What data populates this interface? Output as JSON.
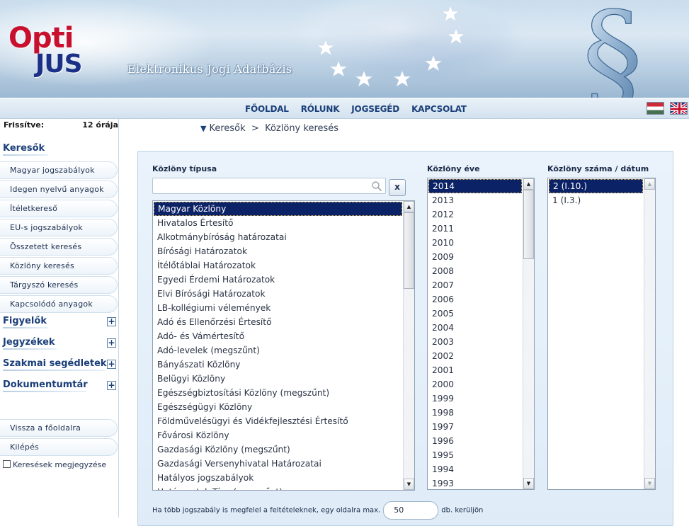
{
  "header": {
    "logo_opti": "Opti",
    "logo_jus": "JUS",
    "subtitle": "Elektronikus Jogi Adatbázis"
  },
  "nav": {
    "items": [
      "FŐOLDAL",
      "RÓLUNK",
      "JOGSEGÉD",
      "KAPCSOLAT"
    ]
  },
  "languages": [
    "hungarian-flag-icon",
    "uk-flag-icon"
  ],
  "sidebar": {
    "updated_label": "Frissítve:",
    "updated_value": "12 órája",
    "search_section": "Keresők",
    "search_items": [
      "Magyar jogszabályok",
      "Idegen nyelvű anyagok",
      "Ítéletkereső",
      "EU-s jogszabályok",
      "Összetett keresés",
      "Közlöny keresés",
      "Tárgyszó keresés",
      "Kapcsolódó anyagok"
    ],
    "collapsible_sections": [
      "Figyelők",
      "Jegyzékek",
      "Szakmai segédletek",
      "Dokumentumtár"
    ],
    "bottom_items": [
      "Vissza a főoldalra",
      "Kilépés"
    ],
    "remember_label": "Keresések megjegyzése"
  },
  "breadcrumb": {
    "root": "Keresők",
    "separator": ">",
    "current": "Közlöny keresés"
  },
  "form": {
    "type_label": "Közlöny típusa",
    "year_label": "Közlöny éve",
    "number_label": "Közlöny száma / dátum",
    "type_search_value": "",
    "clear_label": "x",
    "types": [
      "Magyar Közlöny",
      "Hivatalos Értesítő",
      "Alkotmánybíróság határozatai",
      "Bírósági Határozatok",
      "Ítélőtáblai Határozatok",
      "Egyedi Érdemi Határozatok",
      "Elvi Bírósági Határozatok",
      "LB-kollégiumi vélemények",
      "Adó és Ellenőrzési Értesítő",
      "Adó- és Vámértesítő",
      "Adó-levelek (megszűnt)",
      "Bányászati Közlöny",
      "Belügyi Közlöny",
      "Egészségbiztosítási Közlöny (megszűnt)",
      "Egészségügyi Közlöny",
      "Földművelésügyi és Vidékfejlesztési Értesítő",
      "Fővárosi Közlöny",
      "Gazdasági Közlöny (megszűnt)",
      "Gazdasági Versenyhivatal Határozatai",
      "Hatályos jogszabályok",
      "Határozatok Tára (megszűnt)"
    ],
    "selected_type": "Magyar Közlöny",
    "years": [
      "2014",
      "2013",
      "2012",
      "2011",
      "2010",
      "2009",
      "2008",
      "2007",
      "2006",
      "2005",
      "2004",
      "2003",
      "2002",
      "2001",
      "2000",
      "1999",
      "1998",
      "1997",
      "1996",
      "1995",
      "1994",
      "1993"
    ],
    "selected_year": "2014",
    "numbers": [
      "2 (I.10.)",
      "1 (I.3.)"
    ],
    "selected_number": "2 (I.10.)",
    "max_prefix": "Ha több jogszabály is megfelel a feltételeknek, egy oldalra max.",
    "max_value": "50",
    "max_suffix": "db. kerüljön"
  },
  "colors": {
    "nav_text": "#1b3f7a",
    "selected_bg": "#0c2266",
    "logo_red": "#c8102e",
    "logo_blue": "#1a2f86"
  }
}
